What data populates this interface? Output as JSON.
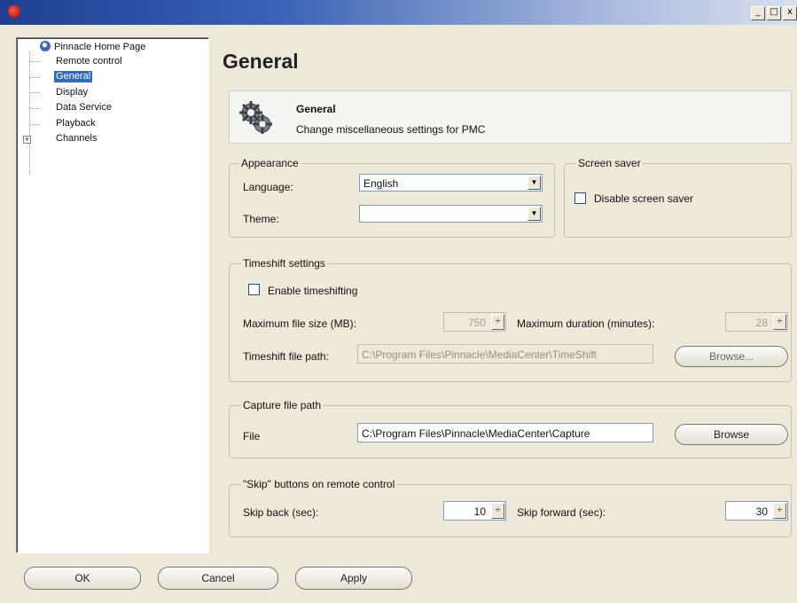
{
  "window": {
    "minimize": "_",
    "maximize": "□",
    "close": "x"
  },
  "tree": {
    "items": [
      {
        "label": "Pinnacle Home Page"
      },
      {
        "label": "Remote control"
      },
      {
        "label": "General"
      },
      {
        "label": "Display"
      },
      {
        "label": "Data Service"
      },
      {
        "label": "Playback"
      },
      {
        "label": "Channels"
      }
    ],
    "expander": "+"
  },
  "page": {
    "heading": "General"
  },
  "banner": {
    "title": "General",
    "description": "Change miscellaneous settings for PMC",
    "icon": "gear-icon"
  },
  "appearance": {
    "legend": "Appearance",
    "language_label": "Language:",
    "language_value": "English",
    "theme_label": "Theme:",
    "theme_value": ""
  },
  "screensaver": {
    "legend": "Screen saver",
    "disable_label": "Disable screen saver",
    "disabled_checked": false
  },
  "timeshift": {
    "legend": "Timeshift settings",
    "enable_label": "Enable timeshifting",
    "enable_checked": false,
    "max_size_label": "Maximum file size (MB):",
    "max_size_value": "750",
    "max_duration_label": "Maximum duration (minutes):",
    "max_duration_value": "28",
    "path_label": "Timeshift file path:",
    "path_value": "C:\\Program Files\\Pinnacle\\MediaCenter\\TimeShift",
    "browse_label": "Browse..."
  },
  "capture": {
    "legend": "Capture file path",
    "file_label": "File",
    "file_value": "C:\\Program Files\\Pinnacle\\MediaCenter\\Capture",
    "browse_label": "Browse"
  },
  "skip": {
    "legend": "\"Skip\" buttons on remote control",
    "back_label": "Skip back (sec):",
    "back_value": "10",
    "forward_label": "Skip forward (sec):",
    "forward_value": "30"
  },
  "footer": {
    "ok_label": "OK",
    "cancel_label": "Cancel",
    "apply_label": "Apply"
  },
  "colors": {
    "selection": "#316ac5",
    "dialog_bg": "#ece9d8",
    "title_gradient_start": "#1e3f8f"
  }
}
